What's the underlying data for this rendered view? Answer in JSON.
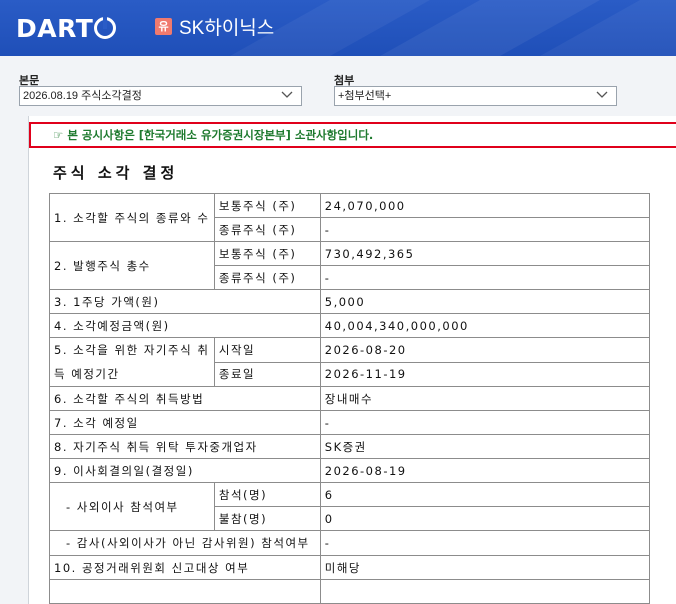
{
  "header": {
    "logo": "DART",
    "company_badge": "유",
    "company_name": "SK하이닉스"
  },
  "selectors": {
    "main_label": "본문",
    "main_value": "2026.08.19  주식소각결정",
    "attach_label": "첨부",
    "attach_value": "+첨부선택+"
  },
  "notice": "☞ 본 공시사항은 [한국거래소 유가증권시장본부] 소관사항입니다.",
  "doc_title": "주식 소각 결정",
  "table": {
    "r1_label": "1. 소각할 주식의 종류와 수",
    "r1a_sub": "보통주식 (주)",
    "r1a_val": "24,070,000",
    "r1b_sub": "종류주식 (주)",
    "r1b_val": "-",
    "r2_label": "2. 발행주식 총수",
    "r2a_sub": "보통주식 (주)",
    "r2a_val": "730,492,365",
    "r2b_sub": "종류주식 (주)",
    "r2b_val": "-",
    "r3_label": "3. 1주당 가액(원)",
    "r3_val": "5,000",
    "r4_label": "4. 소각예정금액(원)",
    "r4_val": "40,004,340,000,000",
    "r5_label": "5. 소각을 위한 자기주식 취득 예정기간",
    "r5a_sub": "시작일",
    "r5a_val": "2026-08-20",
    "r5b_sub": "종료일",
    "r5b_val": "2026-11-19",
    "r6_label": "6. 소각할 주식의 취득방법",
    "r6_val": "장내매수",
    "r7_label": "7. 소각 예정일",
    "r7_val": "-",
    "r8_label": "8. 자기주식 취득 위탁 투자중개업자",
    "r8_val": "SK증권",
    "r9_label": "9. 이사회결의일(결정일)",
    "r9_val": "2026-08-19",
    "r9a_label": "- 사외이사 참석여부",
    "r9a_sub1": "참석(명)",
    "r9a_val1": "6",
    "r9a_sub2": "불참(명)",
    "r9a_val2": "0",
    "r9b_label": "- 감사(사외이사가 아닌 감사위원) 참석여부",
    "r9b_val": "-",
    "r10_label": "10. 공정거래위원회 신고대상 여부",
    "r10_val": "미해당"
  }
}
